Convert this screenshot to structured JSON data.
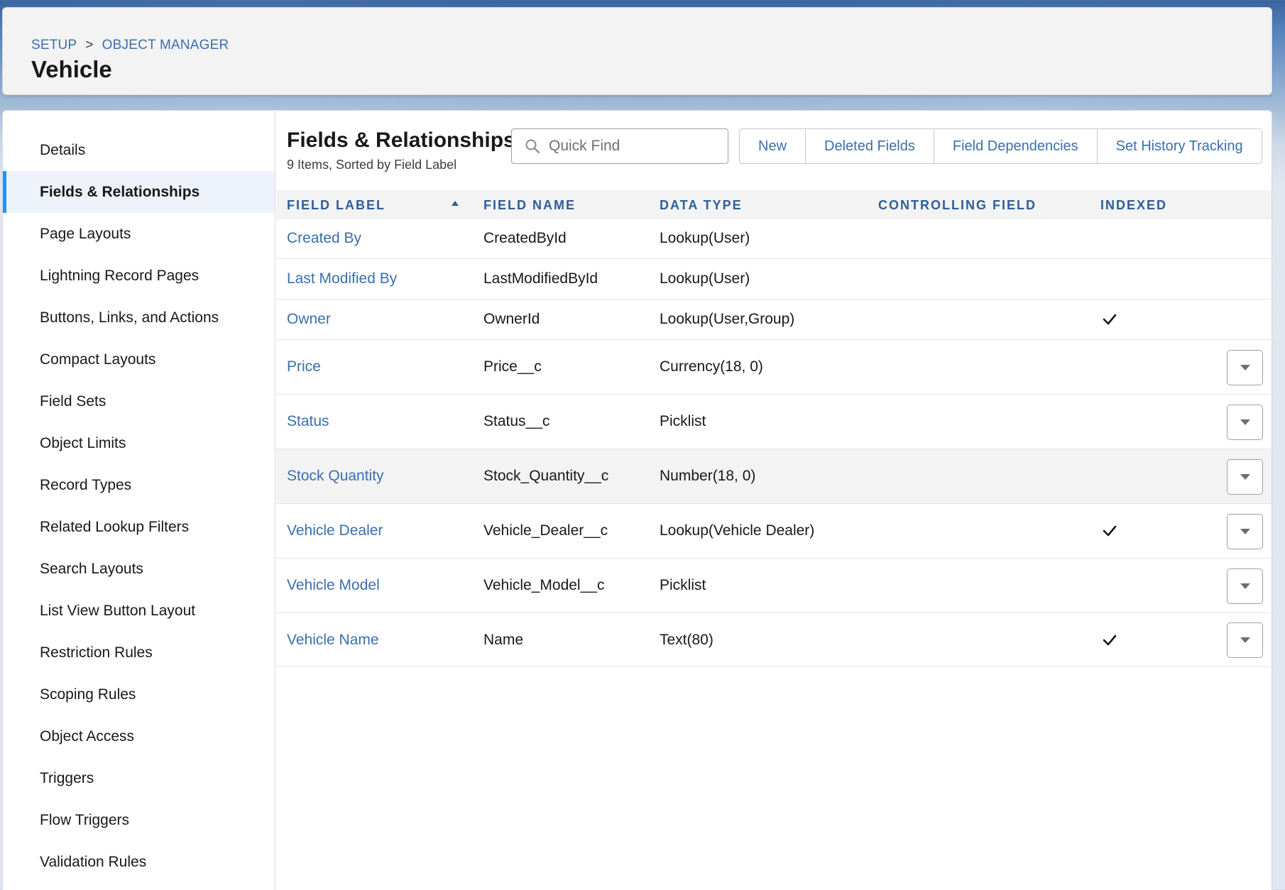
{
  "breadcrumb": {
    "setup": "SETUP",
    "separator": ">",
    "object_manager": "OBJECT MANAGER"
  },
  "page_title": "Vehicle",
  "sidebar": {
    "active_index": 1,
    "items": [
      "Details",
      "Fields & Relationships",
      "Page Layouts",
      "Lightning Record Pages",
      "Buttons, Links, and Actions",
      "Compact Layouts",
      "Field Sets",
      "Object Limits",
      "Record Types",
      "Related Lookup Filters",
      "Search Layouts",
      "List View Button Layout",
      "Restriction Rules",
      "Scoping Rules",
      "Object Access",
      "Triggers",
      "Flow Triggers",
      "Validation Rules"
    ]
  },
  "section": {
    "title": "Fields & Relationships",
    "subtitle": "9 Items, Sorted by Field Label"
  },
  "search": {
    "placeholder": "Quick Find",
    "value": ""
  },
  "toolbar": {
    "new_label": "New",
    "deleted_fields_label": "Deleted Fields",
    "field_dependencies_label": "Field Dependencies",
    "set_history_tracking_label": "Set History Tracking"
  },
  "table": {
    "columns": [
      "FIELD LABEL",
      "FIELD NAME",
      "DATA TYPE",
      "CONTROLLING FIELD",
      "INDEXED"
    ],
    "sort_column": "FIELD LABEL",
    "sort_direction": "ascending",
    "rows": [
      {
        "label": "Created By",
        "name": "CreatedById",
        "type": "Lookup(User)",
        "controlling": "",
        "indexed": false,
        "has_menu": false
      },
      {
        "label": "Last Modified By",
        "name": "LastModifiedById",
        "type": "Lookup(User)",
        "controlling": "",
        "indexed": false,
        "has_menu": false
      },
      {
        "label": "Owner",
        "name": "OwnerId",
        "type": "Lookup(User,Group)",
        "controlling": "",
        "indexed": true,
        "has_menu": false
      },
      {
        "label": "Price",
        "name": "Price__c",
        "type": "Currency(18, 0)",
        "controlling": "",
        "indexed": false,
        "has_menu": true
      },
      {
        "label": "Status",
        "name": "Status__c",
        "type": "Picklist",
        "controlling": "",
        "indexed": false,
        "has_menu": true
      },
      {
        "label": "Stock Quantity",
        "name": "Stock_Quantity__c",
        "type": "Number(18, 0)",
        "controlling": "",
        "indexed": false,
        "has_menu": true,
        "highlighted": true
      },
      {
        "label": "Vehicle Dealer",
        "name": "Vehicle_Dealer__c",
        "type": "Lookup(Vehicle Dealer)",
        "controlling": "",
        "indexed": true,
        "has_menu": true
      },
      {
        "label": "Vehicle Model",
        "name": "Vehicle_Model__c",
        "type": "Picklist",
        "controlling": "",
        "indexed": false,
        "has_menu": true
      },
      {
        "label": "Vehicle Name",
        "name": "Name",
        "type": "Text(80)",
        "controlling": "",
        "indexed": true,
        "has_menu": true
      }
    ]
  },
  "icons": {
    "search": "search-icon",
    "sort": "sort-ascending-icon",
    "check": "check-icon",
    "row_menu": "chevron-down-icon"
  },
  "colors": {
    "link": "#3a6fae",
    "header_text": "#2e5e9b",
    "active_bar": "#1b96ff"
  }
}
